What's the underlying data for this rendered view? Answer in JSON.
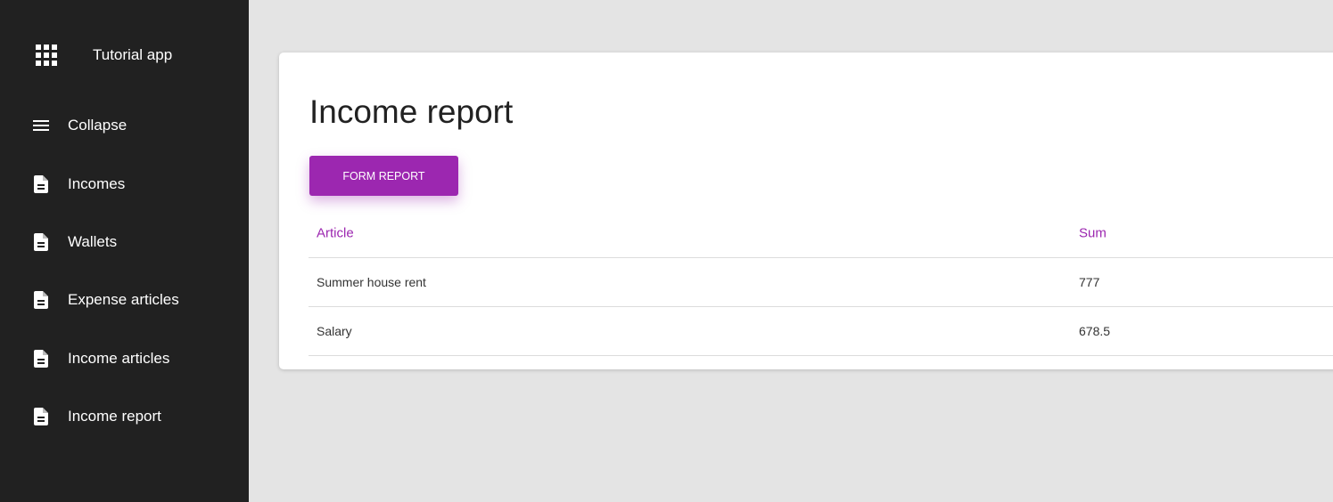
{
  "app": {
    "title": "Tutorial app",
    "icon": "apps-grid-icon"
  },
  "sidebar": {
    "items": [
      {
        "label": "Collapse",
        "icon": "menu-icon"
      },
      {
        "label": "Incomes",
        "icon": "document-icon"
      },
      {
        "label": "Wallets",
        "icon": "document-icon"
      },
      {
        "label": "Expense articles",
        "icon": "document-icon"
      },
      {
        "label": "Income articles",
        "icon": "document-icon"
      },
      {
        "label": "Income report",
        "icon": "document-icon"
      }
    ]
  },
  "main": {
    "title": "Income report",
    "form_button_label": "FORM REPORT",
    "table": {
      "columns": [
        "Article",
        "Sum"
      ],
      "rows": [
        [
          "Summer house rent",
          "777"
        ],
        [
          "Salary",
          "678.5"
        ]
      ]
    }
  },
  "colors": {
    "accent": "#9c27b0",
    "sidebar_bg": "#212121",
    "page_bg": "#e4e4e4"
  }
}
